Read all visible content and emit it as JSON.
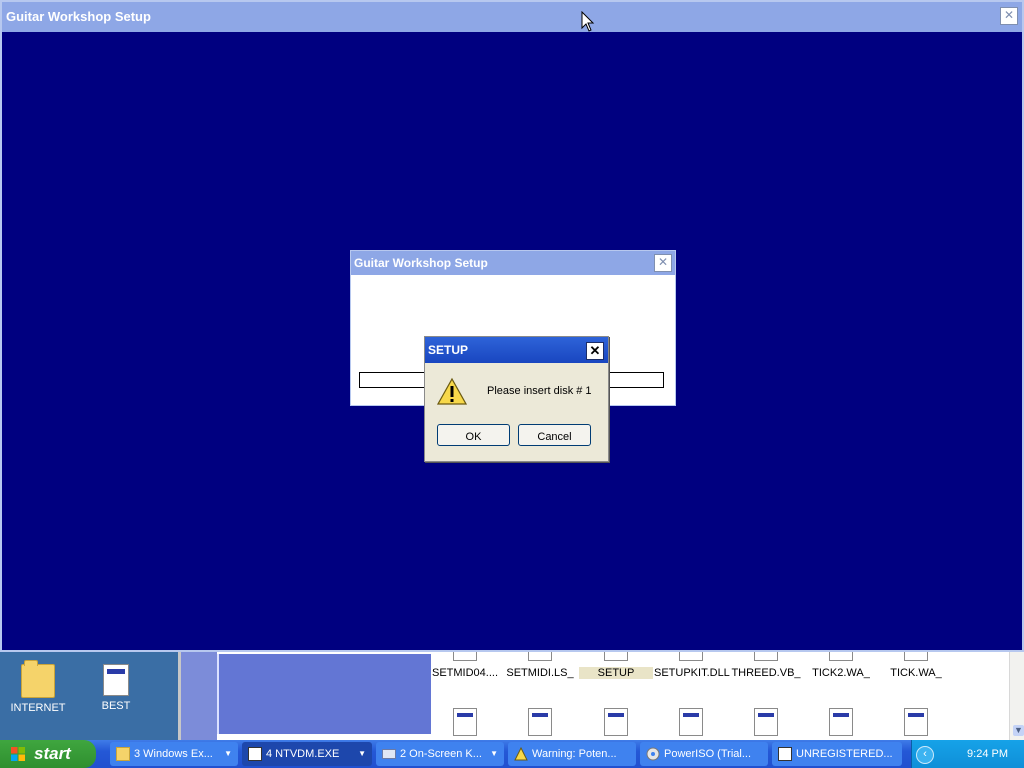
{
  "desktop": {
    "icons": [
      {
        "label": "INTERNET",
        "icon": "folder-icon"
      },
      {
        "label": "BEST",
        "icon": "document-icon"
      }
    ]
  },
  "explorer": {
    "files_row1": [
      {
        "label": "SETMID04...."
      },
      {
        "label": "SETMIDI.LS_"
      },
      {
        "label": "SETUP"
      },
      {
        "label": "SETUPKIT.DLL"
      },
      {
        "label": "THREED.VB_"
      },
      {
        "label": "TICK2.WA_"
      },
      {
        "label": "TICK.WA_"
      }
    ]
  },
  "main_window": {
    "title": "Guitar Workshop Setup",
    "close": "✕"
  },
  "inner_window": {
    "title": "Guitar Workshop Setup",
    "close": "✕"
  },
  "dialog": {
    "title": "SETUP",
    "close": "✕",
    "message": "Please insert disk # 1",
    "ok_label": "OK",
    "cancel_label": "Cancel",
    "icon": "warning-icon"
  },
  "taskbar": {
    "start_label": "start",
    "tasks": [
      {
        "label": "3 Windows Ex...",
        "icon": "folder-icon"
      },
      {
        "label": "4 NTVDM.EXE",
        "icon": "window-icon"
      },
      {
        "label": "2 On-Screen K...",
        "icon": "keyboard-icon"
      },
      {
        "label": "Warning: Poten...",
        "icon": "warning-icon"
      },
      {
        "label": "PowerISO (Trial...",
        "icon": "disc-icon"
      },
      {
        "label": "UNREGISTERED...",
        "icon": "app-icon"
      }
    ],
    "clock": "9:24 PM"
  }
}
